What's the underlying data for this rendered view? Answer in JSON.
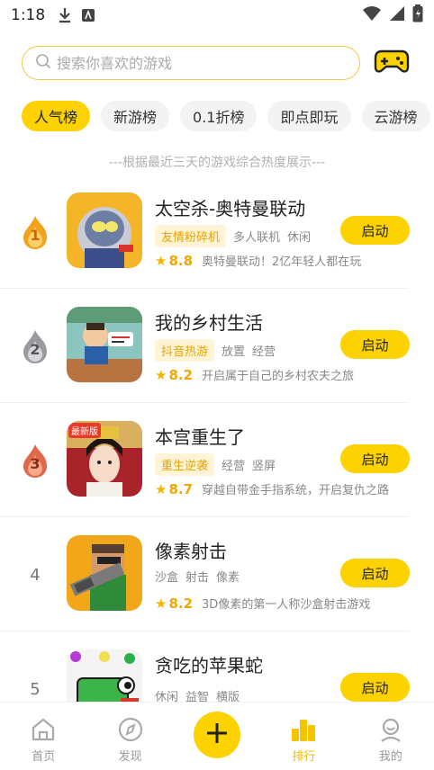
{
  "status": {
    "time": "1:18"
  },
  "search": {
    "placeholder": "搜索你喜欢的游戏"
  },
  "tabs": [
    {
      "label": "人气榜",
      "active": true
    },
    {
      "label": "新游榜",
      "active": false
    },
    {
      "label": "0.1折榜",
      "active": false
    },
    {
      "label": "即点即玩",
      "active": false
    },
    {
      "label": "云游榜",
      "active": false
    }
  ],
  "subtitle": "---根据最近三天的游戏综合热度展示---",
  "games": [
    {
      "rank": "1",
      "title": "太空杀-奥特曼联动",
      "hot_tag": "友情粉碎机",
      "tags": [
        "多人联机",
        "休闲"
      ],
      "score": "8.8",
      "desc": "奥特曼联动！2亿年轻人都在玩",
      "button": "启动"
    },
    {
      "rank": "2",
      "title": "我的乡村生活",
      "hot_tag": "抖音热游",
      "tags": [
        "放置",
        "经营"
      ],
      "score": "8.2",
      "desc": "开启属于自己的乡村农夫之旅",
      "button": "启动"
    },
    {
      "rank": "3",
      "title": "本宫重生了",
      "hot_tag": "重生逆袭",
      "tags": [
        "经营",
        "竖屏"
      ],
      "score": "8.7",
      "desc": "穿越自带金手指系统，开启复仇之路",
      "button": "启动",
      "thumb_badge": "最新版"
    },
    {
      "rank": "4",
      "title": "像素射击",
      "hot_tag": "",
      "tags": [
        "沙盒",
        "射击",
        "像素"
      ],
      "score": "8.2",
      "desc": "3D像素的第一人称沙盒射击游戏",
      "button": "启动"
    },
    {
      "rank": "5",
      "title": "贪吃的苹果蛇",
      "hot_tag": "",
      "tags": [
        "休闲",
        "益智",
        "横版"
      ],
      "score": "",
      "desc": "",
      "button": "启动"
    }
  ],
  "nav": [
    {
      "label": "首页",
      "icon": "home-icon",
      "active": false
    },
    {
      "label": "发现",
      "icon": "compass-icon",
      "active": false
    },
    {
      "label": "",
      "icon": "plus-icon",
      "active": false
    },
    {
      "label": "排行",
      "icon": "ranking-icon",
      "active": true
    },
    {
      "label": "我的",
      "icon": "profile-icon",
      "active": false
    }
  ],
  "colors": {
    "accent": "#fcd200",
    "score": "#f0a800",
    "rank1": "#f2a21c",
    "rank2": "#9a9aa0",
    "rank3": "#e0684a"
  }
}
